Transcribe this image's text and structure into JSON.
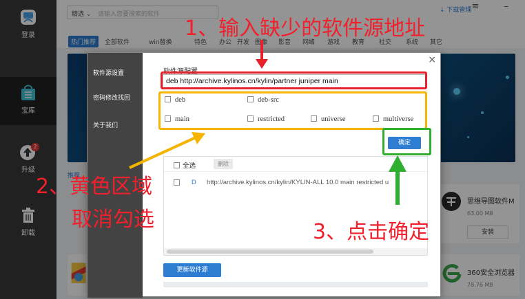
{
  "sidebar": {
    "items": [
      {
        "label": "登录"
      },
      {
        "label": "宝库"
      },
      {
        "label": "升级",
        "badge": "2"
      },
      {
        "label": "卸载"
      }
    ]
  },
  "topbar": {
    "search_select": "精选 ⌄",
    "search_placeholder": "请输入您要搜索的软件",
    "download_manager": "⇣ 下载管理",
    "window_buttons": "≡ –"
  },
  "categories": [
    "热门推荐",
    "全部软件",
    "win替换",
    "特色",
    "办公",
    "开发",
    "图像",
    "影音",
    "网络",
    "游戏",
    "教育",
    "社交",
    "系统",
    "其它"
  ],
  "background": {
    "section_label": "推荐",
    "apps": [
      {
        "name": "思维导图软件M",
        "size": "63.00 MB",
        "action": "安装"
      },
      {
        "name": "360安全浏览器",
        "size": "78.76 MB"
      }
    ]
  },
  "dialog": {
    "close": "×",
    "side_items": [
      "软件源设置",
      "密码修改找回",
      "关于我们"
    ],
    "section_title": "软件源配置",
    "source_value": "deb http://archive.kylinos.cn/kylin/partner juniper main",
    "checkboxes": [
      "deb",
      "deb-src",
      "main",
      "restricted",
      "universe",
      "multiverse"
    ],
    "ok_label": "确定",
    "select_all": "全选",
    "delete_label": "删除",
    "row_type": "D",
    "row_url": "http://archive.kylinos.cn/kylin/KYLIN-ALL 10.0 main restricted u",
    "update_label": "更新软件源"
  },
  "annotations": {
    "step1": "1、输入缺少的软件源地址",
    "step2_line1": "2、黄色区域",
    "step2_line2": "取消勾选",
    "step3": "3、点击确定"
  },
  "colors": {
    "accent": "#2d7dd2",
    "annotation_red": "#f0202c",
    "highlight_red": "#e8202a",
    "highlight_yellow": "#f4b400",
    "highlight_green": "#2fae2f"
  }
}
